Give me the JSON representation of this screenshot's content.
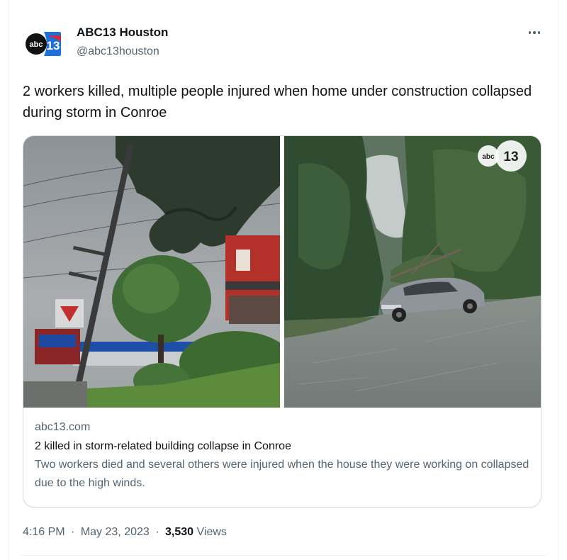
{
  "author": {
    "display_name": "ABC13 Houston",
    "handle": "@abc13houston",
    "avatar_logo_text": "abc13"
  },
  "tweet": {
    "text": "2 workers killed, multiple people injured when home under construction collapsed during storm in Conroe"
  },
  "card": {
    "domain": "abc13.com",
    "title": "2 killed in storm-related building collapse in Conroe",
    "description": "Two workers died and several others were injured when the house they were working on collapsed due to the high winds.",
    "watermark_text": "abc13"
  },
  "meta": {
    "time": "4:16 PM",
    "separator": "·",
    "date": "May 23, 2023",
    "views_count": "3,530",
    "views_label": "Views"
  },
  "colors": {
    "text_primary": "#0f1419",
    "text_secondary": "#536471",
    "border": "#cfd9de",
    "abc_black": "#111111",
    "abc_blue": "#1da1f2",
    "abc_red": "#e0252e"
  },
  "icons": {
    "more": "more-horizontal-icon",
    "avatar": "abc13-logo"
  }
}
